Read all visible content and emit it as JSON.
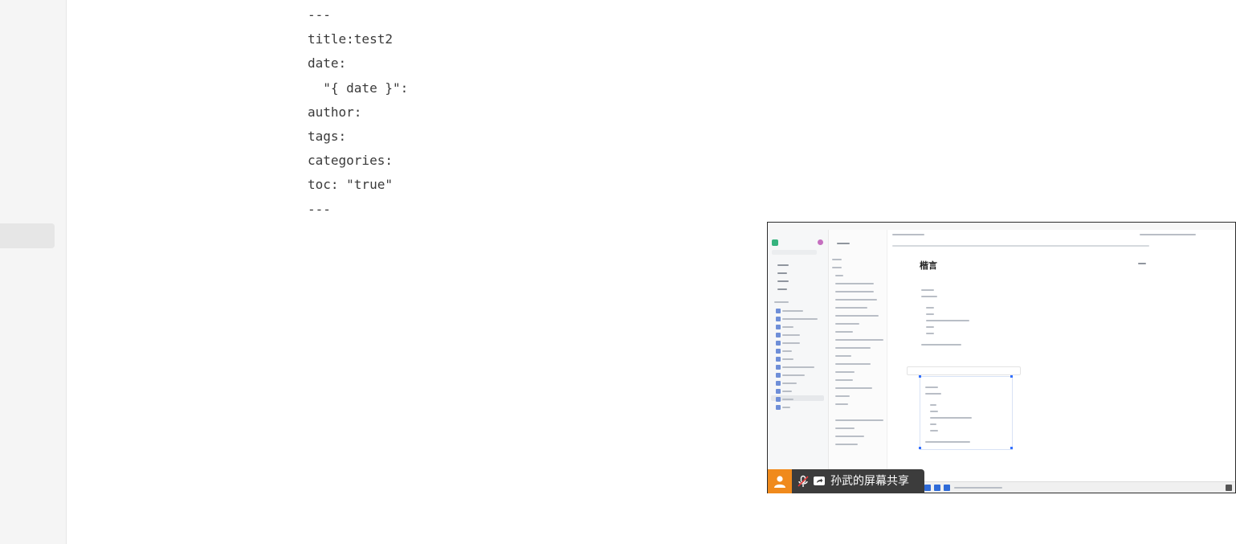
{
  "editor": {
    "lines": [
      "---",
      "title:test2",
      "date:",
      "  \"{ date }\":",
      "author:",
      "tags:",
      "categories:",
      "toc: \"true\"",
      "---"
    ]
  },
  "screen_share": {
    "label": "孙武的屏幕共享",
    "inner_heading": "楷言",
    "user_icon": "person-icon",
    "mic_icon": "mic-muted-icon",
    "share_icon": "share-screen-icon",
    "accent": "#f08a1c"
  }
}
